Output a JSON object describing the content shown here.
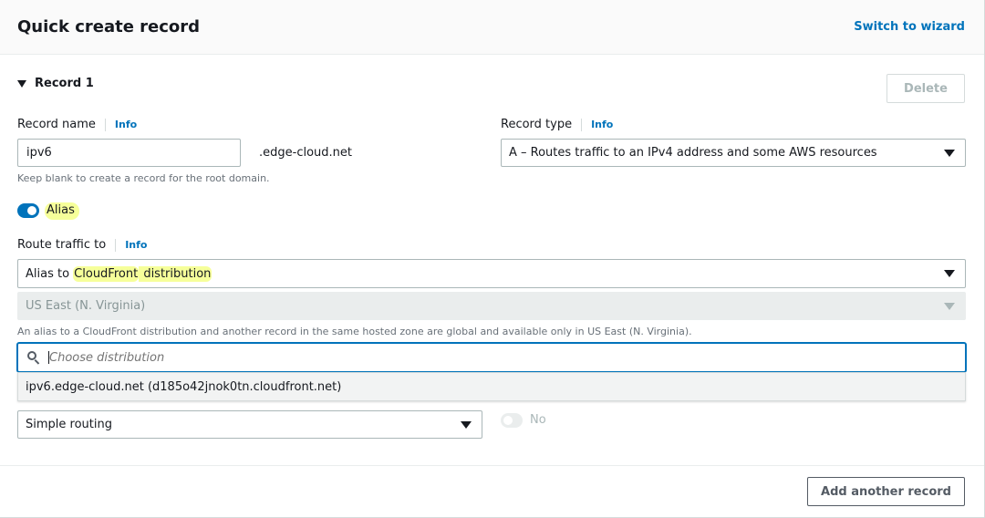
{
  "header": {
    "title": "Quick create record",
    "switch_label": "Switch to wizard"
  },
  "record": {
    "title": "Record 1",
    "delete_label": "Delete",
    "record_name": {
      "label": "Record name",
      "info": "Info",
      "value": "ipv6",
      "suffix": ".edge-cloud.net",
      "hint": "Keep blank to create a record for the root domain."
    },
    "record_type": {
      "label": "Record type",
      "info": "Info",
      "value": "A – Routes traffic to an IPv4 address and some AWS resources"
    },
    "alias": {
      "label": "Alias",
      "enabled": true
    },
    "route_traffic": {
      "label": "Route traffic to",
      "info": "Info",
      "endpoint_prefix": "Alias to ",
      "endpoint_highlight": "CloudFront",
      "endpoint_suffix": " distribution",
      "region": "US East (N. Virginia)",
      "region_hint": "An alias to a CloudFront distribution and another record in the same hosted zone are global and available only in US East (N. Virginia).",
      "search_placeholder": "Choose distribution",
      "options": [
        "ipv6.edge-cloud.net (d185o42jnok0tn.cloudfront.net)"
      ]
    },
    "routing_policy": {
      "value": "Simple routing"
    },
    "health": {
      "label": "No",
      "enabled": false
    }
  },
  "footer": {
    "add_label": "Add another record"
  },
  "colors": {
    "accent": "#0073bb",
    "highlight": "#f6ff9a"
  }
}
